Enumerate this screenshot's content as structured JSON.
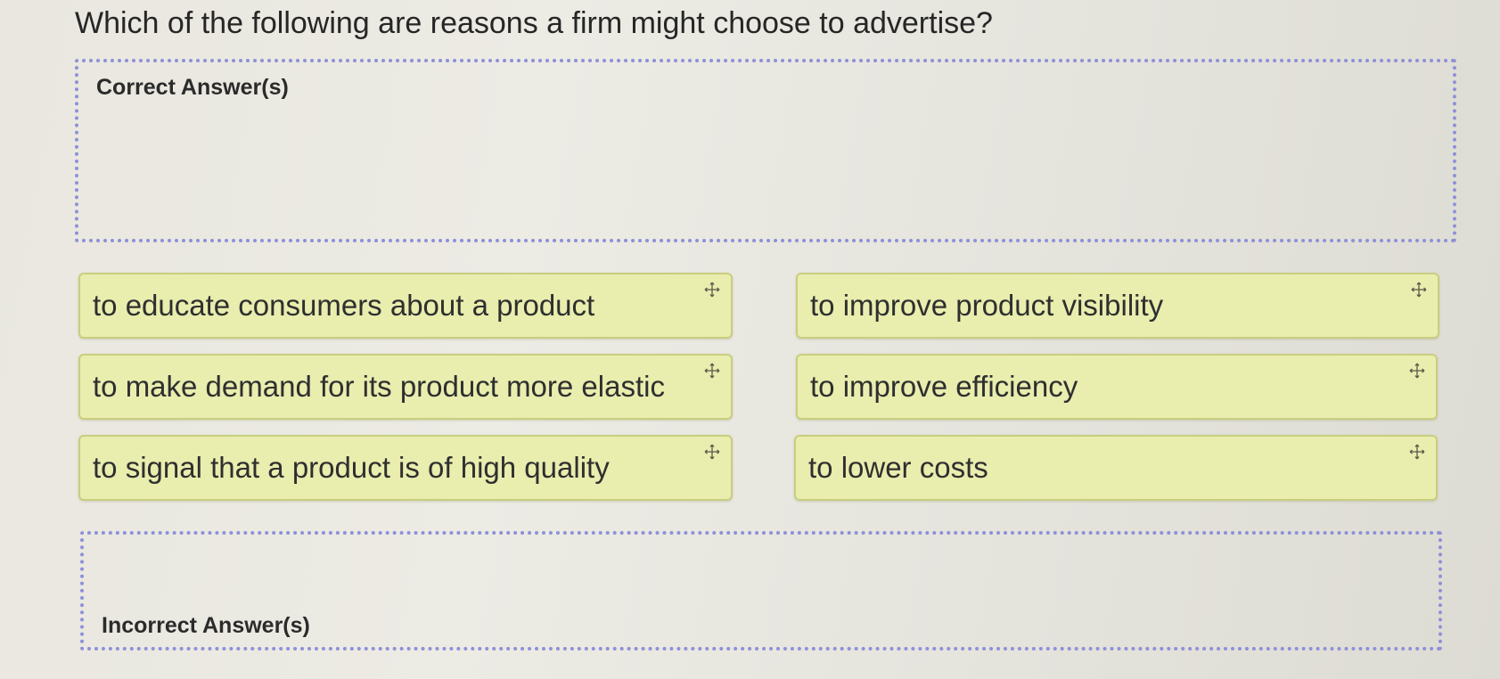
{
  "question": {
    "text": "Which of the following are reasons a firm might choose to advertise?"
  },
  "zones": {
    "correct_label": "Correct Answer(s)",
    "incorrect_label": "Incorrect Answer(s)"
  },
  "cards": [
    {
      "text": "to educate consumers about a product",
      "icon": "move-icon"
    },
    {
      "text": "to improve product visibility",
      "icon": "move-icon"
    },
    {
      "text": "to make demand for its product more elastic",
      "icon": "move-icon"
    },
    {
      "text": "to improve efficiency",
      "icon": "move-icon"
    },
    {
      "text": "to signal that a product is of high quality",
      "icon": "move-icon"
    },
    {
      "text": "to lower costs",
      "icon": "move-icon"
    }
  ],
  "colors": {
    "card_background": "#e9edae",
    "card_border": "#c9ce7f",
    "dropzone_border": "#8e90d8"
  }
}
